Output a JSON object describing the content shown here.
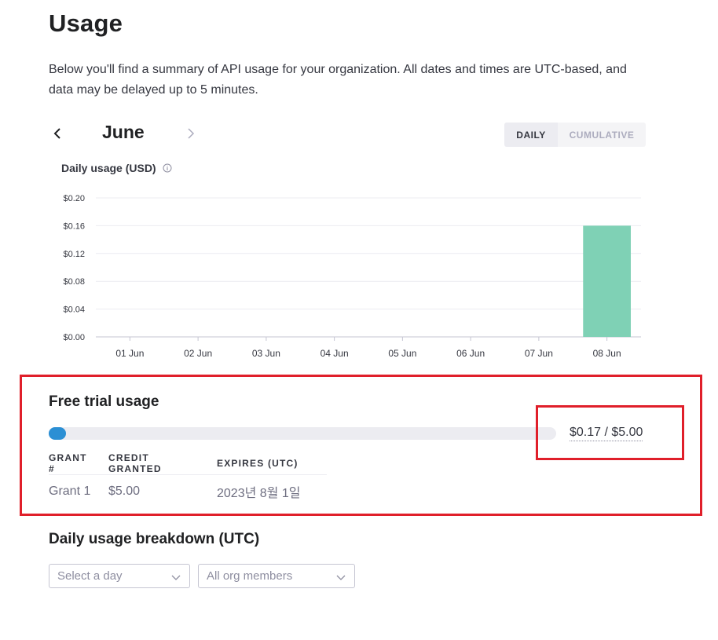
{
  "page": {
    "title": "Usage",
    "intro": "Below you'll find a summary of API usage for your organization. All dates and times are UTC-based, and data may be delayed up to 5 minutes."
  },
  "month_nav": {
    "month": "June"
  },
  "view_toggle": {
    "daily_label": "DAILY",
    "cumulative_label": "CUMULATIVE",
    "selected": "DAILY"
  },
  "chart_title": "Daily usage (USD)",
  "chart_data": {
    "type": "bar",
    "title": "Daily usage (USD)",
    "xlabel": "",
    "ylabel": "",
    "categories": [
      "01 Jun",
      "02 Jun",
      "03 Jun",
      "04 Jun",
      "05 Jun",
      "06 Jun",
      "07 Jun",
      "08 Jun"
    ],
    "values": [
      0,
      0,
      0,
      0,
      0,
      0,
      0,
      0.16
    ],
    "ylim": [
      0,
      0.2
    ],
    "yticks": [
      "$0.00",
      "$0.04",
      "$0.08",
      "$0.12",
      "$0.16",
      "$0.20"
    ],
    "ytick_values": [
      0,
      0.04,
      0.08,
      0.12,
      0.16,
      0.2
    ],
    "grid": true,
    "bar_color": "#7fd1b5"
  },
  "free_trial": {
    "title": "Free trial usage",
    "amount_text": "$0.17 / $5.00",
    "used": 0.17,
    "total": 5.0,
    "progress_color": "#2b8fd4",
    "highlight_color": "#e01f2a",
    "table": {
      "headers": [
        "GRANT #",
        "CREDIT GRANTED",
        "EXPIRES (UTC)"
      ],
      "rows": [
        [
          "Grant 1",
          "$5.00",
          "2023년 8월 1일"
        ]
      ]
    }
  },
  "breakdown": {
    "title": "Daily usage breakdown (UTC)",
    "day_select": "Select a day",
    "members_select": "All org members"
  }
}
